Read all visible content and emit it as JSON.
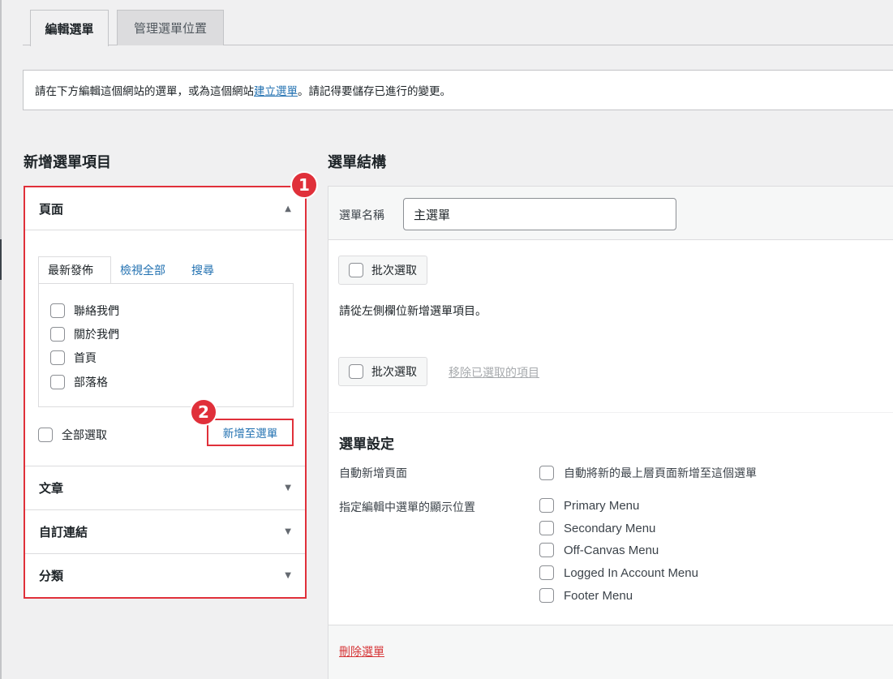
{
  "tabs": {
    "edit": "編輯選單",
    "locations": "管理選單位置"
  },
  "notice": {
    "before": "請在下方編輯這個網站的選單，或為這個網站",
    "link": "建立選單",
    "after": "。請記得要儲存已進行的變更。"
  },
  "left": {
    "title": "新增選單項目",
    "sections": [
      "頁面",
      "文章",
      "自訂連結",
      "分類"
    ],
    "subtabs": [
      "最新發佈",
      "檢視全部",
      "搜尋"
    ],
    "pages": [
      "聯絡我們",
      "關於我們",
      "首頁",
      "部落格"
    ],
    "select_all": "全部選取",
    "add_button": "新增至選單"
  },
  "badges": [
    "1",
    "2"
  ],
  "right": {
    "title": "選單結構",
    "name_label": "選單名稱",
    "name_value": "主選單",
    "bulk_select": "批次選取",
    "hint": "請從左側欄位新增選單項目。",
    "remove_selected": "移除已選取的項目",
    "settings_title": "選單設定",
    "auto_add_label": "自動新增頁面",
    "auto_add_option": "自動將新的最上層頁面新增至這個選單",
    "locations_label": "指定編輯中選單的顯示位置",
    "locations": [
      "Primary Menu",
      "Secondary Menu",
      "Off-Canvas Menu",
      "Logged In Account Menu",
      "Footer Menu"
    ],
    "delete_menu": "刪除選單"
  },
  "colors": {
    "highlight": "#e0303a",
    "link": "#2271b1",
    "delete": "#d63638"
  },
  "icons": {
    "expand_open": "triangle-up-icon",
    "expand_closed": "triangle-down-icon"
  }
}
